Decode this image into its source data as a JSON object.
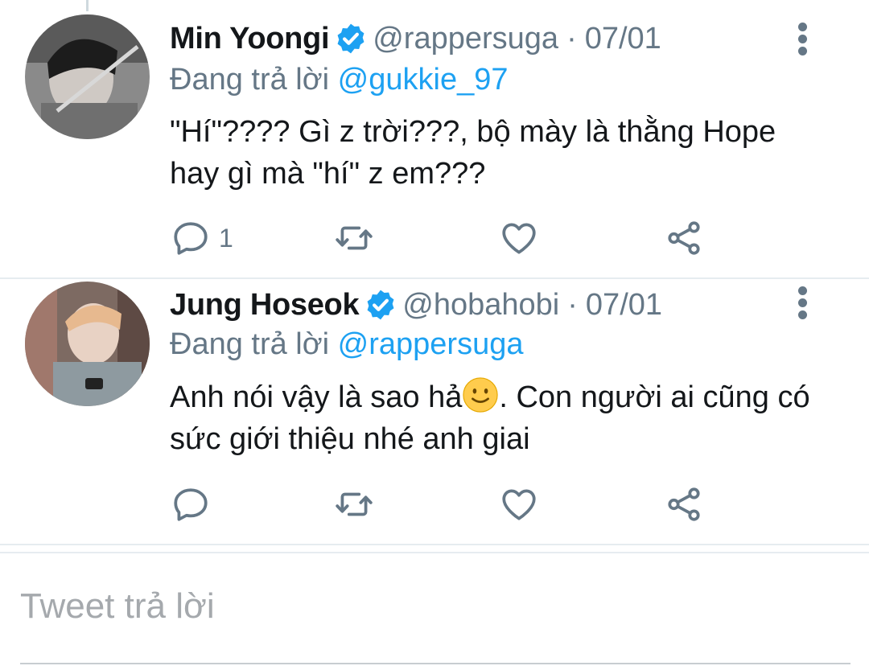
{
  "colors": {
    "accent": "#1da1f2",
    "muted": "#657786",
    "text": "#14171a",
    "divider": "#e6ecf0"
  },
  "tweets": [
    {
      "name": "Min Yoongi",
      "handle": "@rappersuga",
      "separator": "·",
      "date": "07/01",
      "replying_prefix": "Đang trả lời",
      "replying_to": "@gukkie_97",
      "text": "\"Hí\"???? Gì z trời???, bộ mày là thằng Hope hay gì mà \"hí\" z em???",
      "reply_count": "1",
      "icons": [
        "reply-icon",
        "retweet-icon",
        "like-icon",
        "share-icon"
      ]
    },
    {
      "name": "Jung Hoseok",
      "handle": "@hobahobi",
      "separator": "·",
      "date": "07/01",
      "replying_prefix": "Đang trả lời",
      "replying_to": "@rappersuga",
      "text_before_emoji": "Anh nói vậy là sao hả",
      "text_after_emoji": ". Con người ai cũng có sức giới thiệu nhé anh giai",
      "reply_count": "",
      "icons": [
        "reply-icon",
        "retweet-icon",
        "like-icon",
        "share-icon"
      ]
    }
  ],
  "compose": {
    "placeholder": "Tweet trả lời"
  }
}
